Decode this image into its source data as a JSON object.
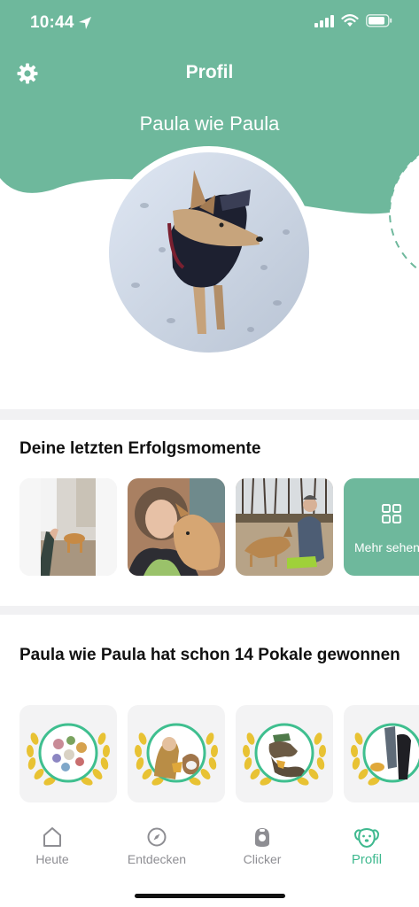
{
  "status_bar": {
    "time": "10:44"
  },
  "header": {
    "title": "Profil",
    "dog_name": "Paula wie Paula",
    "accent_color": "#6eb89c"
  },
  "settings": {
    "icon": "gear-icon"
  },
  "moments": {
    "title": "Deine letzten Erfolgsmomente",
    "more_label": "Mehr sehen",
    "more_icon": "grid-icon"
  },
  "trophies": {
    "title": "Paula wie Paula  hat schon 14 Pokale gewonnen",
    "count": 14
  },
  "tabbar": {
    "tabs": [
      {
        "label": "Heute",
        "icon": "house-icon",
        "active": false
      },
      {
        "label": "Entdecken",
        "icon": "compass-icon",
        "active": false
      },
      {
        "label": "Clicker",
        "icon": "clicker-icon",
        "active": false
      },
      {
        "label": "Profil",
        "icon": "dog-face-icon",
        "active": true
      }
    ],
    "active_color": "#3fb98f",
    "inactive_color": "#8e8e93"
  }
}
